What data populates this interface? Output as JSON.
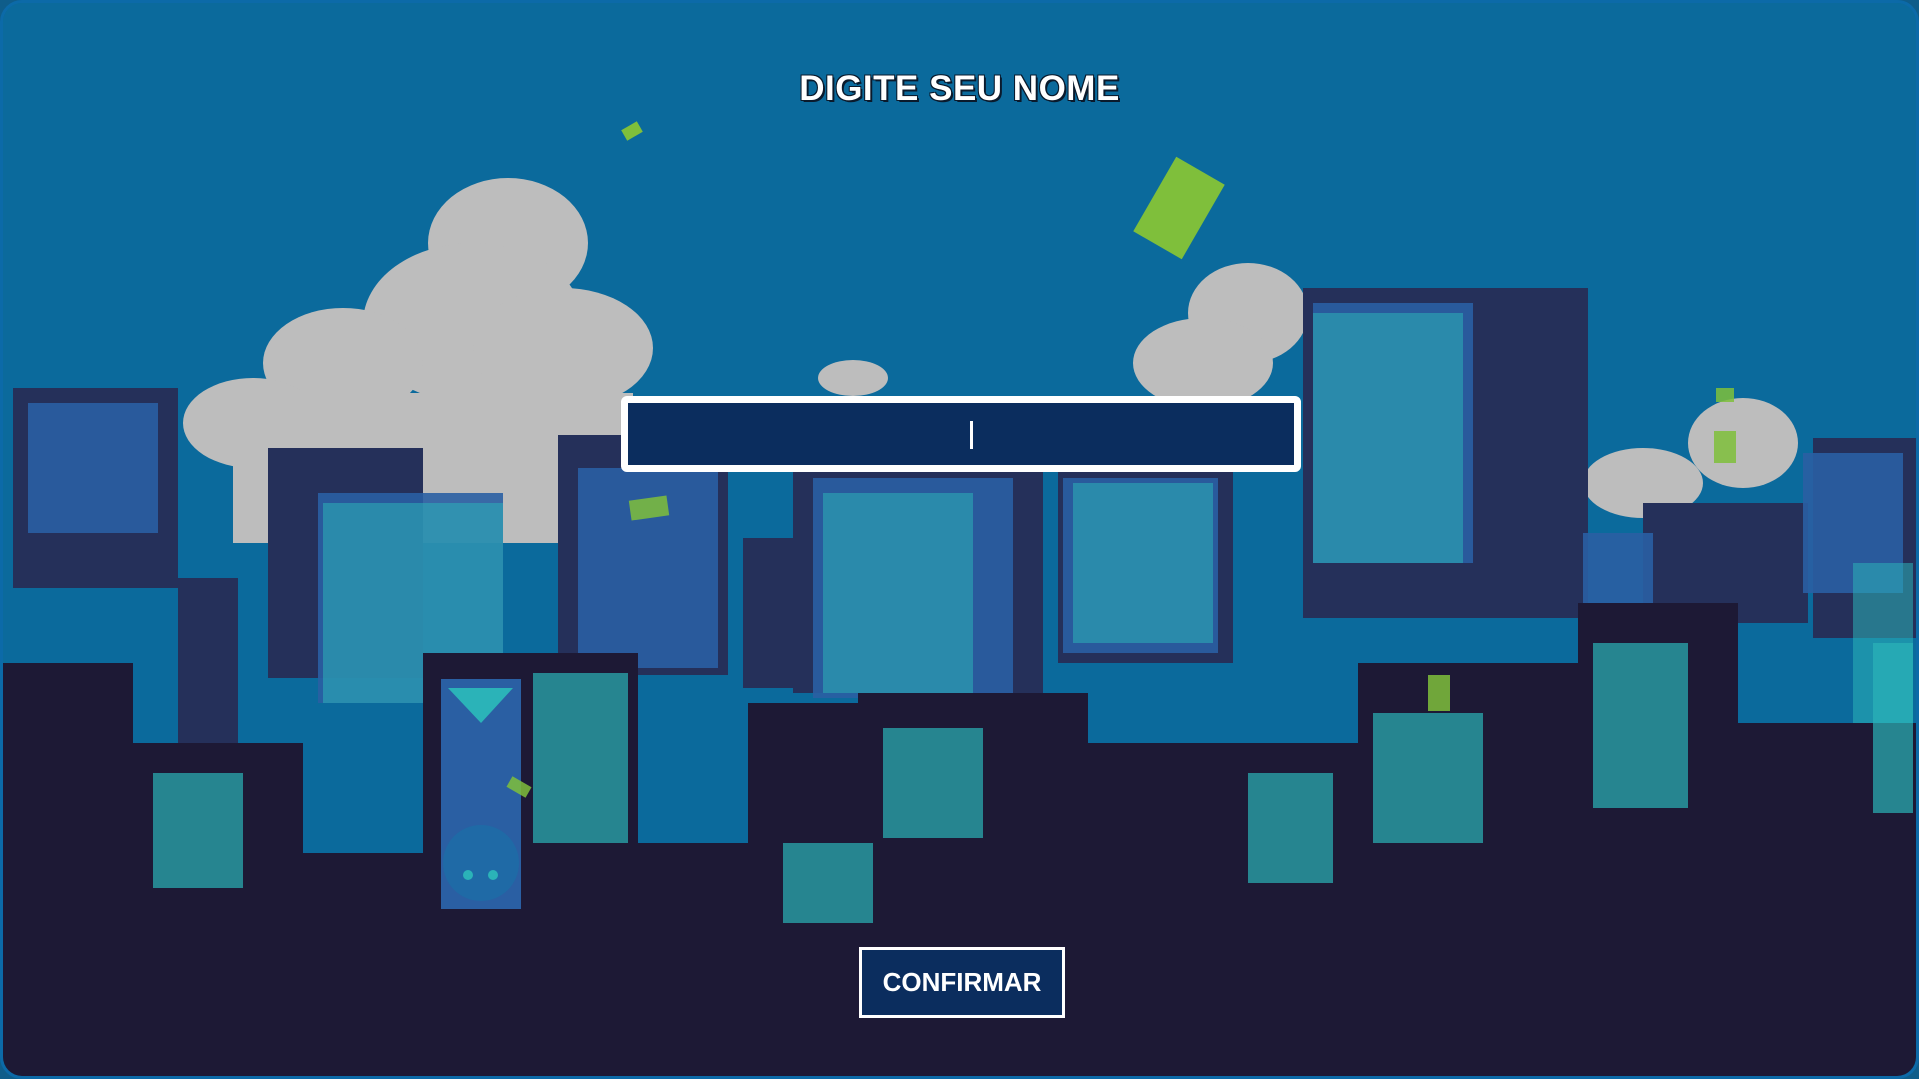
{
  "screen": {
    "title": "DIGITE SEU NOME"
  },
  "name_input": {
    "value": "",
    "placeholder": ""
  },
  "confirm_button": {
    "label": "CONFIRMAR"
  },
  "colors": {
    "sky": "#0b6a9c",
    "frame_border": "#0c6aa8",
    "cloud": "#bdbdbd",
    "building_dark": "#1d1935",
    "building_mid": "#25305a",
    "window_cyan": "#2bb3b8",
    "input_bg": "#0b2d5e",
    "money_green": "#7fbf3b"
  },
  "decorations": {
    "falling_item_icon": "money-bill-icon",
    "billboard_icon": "creature-billboard-icon"
  }
}
